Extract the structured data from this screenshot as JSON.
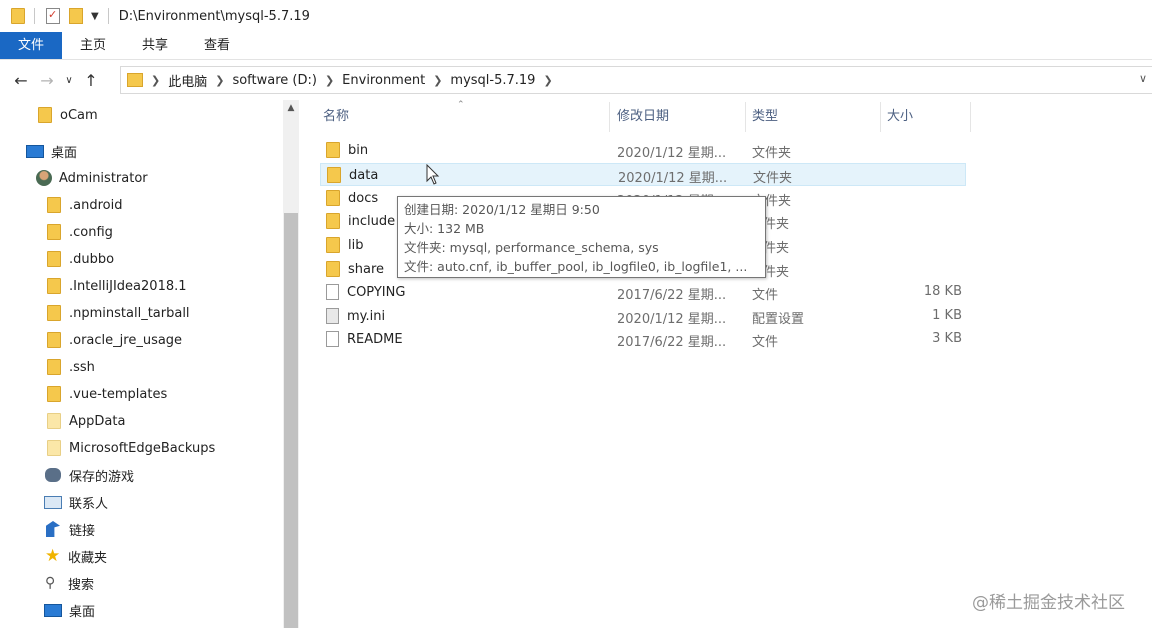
{
  "window": {
    "title": "D:\\Environment\\mysql-5.7.19"
  },
  "ribbon": {
    "tabs": [
      "文件",
      "主页",
      "共享",
      "查看"
    ]
  },
  "nav": {
    "back_icon": "back-arrow-icon",
    "forward_icon": "forward-arrow-icon",
    "recent_icon": "chevron-down-icon",
    "up_icon": "up-arrow-icon",
    "breadcrumbs": [
      "此电脑",
      "software (D:)",
      "Environment",
      "mysql-5.7.19"
    ]
  },
  "sidebar": {
    "items": [
      {
        "label": "oCam",
        "icon": "folder-icon"
      },
      {
        "label": "桌面",
        "icon": "desktop-icon"
      },
      {
        "label": "Administrator",
        "icon": "user-icon"
      },
      {
        "label": ".android",
        "icon": "folder-icon"
      },
      {
        "label": ".config",
        "icon": "folder-icon"
      },
      {
        "label": ".dubbo",
        "icon": "folder-icon"
      },
      {
        "label": ".IntelliJIdea2018.1",
        "icon": "folder-icon"
      },
      {
        "label": ".npminstall_tarball",
        "icon": "folder-icon"
      },
      {
        "label": ".oracle_jre_usage",
        "icon": "folder-icon"
      },
      {
        "label": ".ssh",
        "icon": "folder-icon"
      },
      {
        "label": ".vue-templates",
        "icon": "folder-icon"
      },
      {
        "label": "AppData",
        "icon": "folder-icon"
      },
      {
        "label": "MicrosoftEdgeBackups",
        "icon": "folder-icon"
      },
      {
        "label": "保存的游戏",
        "icon": "saved-games-icon"
      },
      {
        "label": "联系人",
        "icon": "contacts-icon"
      },
      {
        "label": "链接",
        "icon": "links-icon"
      },
      {
        "label": "收藏夹",
        "icon": "star-icon"
      },
      {
        "label": "搜索",
        "icon": "search-icon"
      },
      {
        "label": "桌面",
        "icon": "desktop-icon"
      }
    ]
  },
  "columns": {
    "name": "名称",
    "date": "修改日期",
    "type": "类型",
    "size": "大小"
  },
  "files": [
    {
      "name": "bin",
      "date": "2020/1/12 星期...",
      "type": "文件夹",
      "size": ""
    },
    {
      "name": "data",
      "date": "2020/1/12 星期...",
      "type": "文件夹",
      "size": ""
    },
    {
      "name": "docs",
      "date": "2020/1/12 星期...",
      "type": "文件夹",
      "size": ""
    },
    {
      "name": "include",
      "date": "",
      "type": "件夹",
      "size": ""
    },
    {
      "name": "lib",
      "date": "",
      "type": "件夹",
      "size": ""
    },
    {
      "name": "share",
      "date": "",
      "type": "件夹",
      "size": ""
    },
    {
      "name": "COPYING",
      "date": "2017/6/22 星期...",
      "type": "文件",
      "size": "18 KB"
    },
    {
      "name": "my.ini",
      "date": "2020/1/12 星期...",
      "type": "配置设置",
      "size": "1 KB"
    },
    {
      "name": "README",
      "date": "2017/6/22 星期...",
      "type": "文件",
      "size": "3 KB"
    }
  ],
  "tooltip": {
    "lines": [
      "创建日期: 2020/1/12 星期日 9:50",
      "大小: 132 MB",
      "文件夹: mysql, performance_schema, sys",
      "文件: auto.cnf, ib_buffer_pool, ib_logfile0, ib_logfile1, ..."
    ]
  },
  "watermark": "@稀土掘金技术社区"
}
